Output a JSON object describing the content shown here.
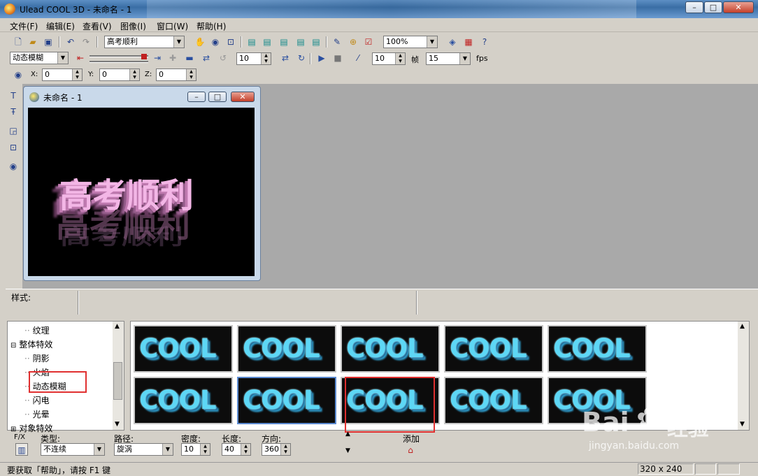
{
  "window": {
    "title": "Ulead COOL 3D - 未命名 - 1",
    "min_glyph": "–",
    "max_glyph": "□",
    "close_glyph": "✕"
  },
  "menu": {
    "items": [
      "文件(F)",
      "编辑(E)",
      "查看(V)",
      "图像(I)",
      "窗口(W)",
      "帮助(H)"
    ]
  },
  "toolbar1": {
    "text_combo": "高考顺利",
    "zoom_combo": "100%"
  },
  "toolbar2": {
    "effect_combo": "动态模糊",
    "frames_value": "10",
    "frames_value2": "10",
    "frame_label": "帧",
    "fps_value": "15",
    "fps_label": "fps"
  },
  "toolbar3": {
    "x_label": "X:",
    "x_value": "0",
    "y_label": "Y:",
    "y_value": "0",
    "z_label": "Z:",
    "z_value": "0"
  },
  "document": {
    "title": "未命名 - 1",
    "canvas_text": "高考顺利"
  },
  "style_bar": {
    "label": "样式:"
  },
  "tree": {
    "items": [
      {
        "label": "纹理",
        "indent": 2,
        "expander": ""
      },
      {
        "label": "整体特效",
        "indent": 1,
        "expander": "⊟"
      },
      {
        "label": "阴影",
        "indent": 2,
        "expander": ""
      },
      {
        "label": "火焰",
        "indent": 2,
        "expander": ""
      },
      {
        "label": "动态模糊",
        "indent": 2,
        "expander": ""
      },
      {
        "label": "闪电",
        "indent": 2,
        "expander": ""
      },
      {
        "label": "光晕",
        "indent": 2,
        "expander": ""
      },
      {
        "label": "对象特效",
        "indent": 1,
        "expander": "⊞"
      }
    ],
    "highlighted": "动态模糊"
  },
  "gallery": {
    "thumb_text": "COOL",
    "thumbs": [
      1,
      2,
      3,
      4,
      5,
      6,
      7,
      8,
      9,
      10
    ],
    "selected_index": 7
  },
  "params": {
    "fx_label": "F/X",
    "type_label": "类型:",
    "type_value": "不连续",
    "path_label": "路径:",
    "path_value": "旋涡",
    "density_label": "密度:",
    "density_value": "10",
    "length_label": "长度:",
    "length_value": "40",
    "direction_label": "方向:",
    "direction_value": "360",
    "add_label": "添加"
  },
  "status": {
    "help_text": "要获取「帮助」，请按 F1 键",
    "size": "320 x 240"
  },
  "watermark": {
    "brand": "Bai",
    "brand2": "经验",
    "url": "jingyan.baidu.com"
  },
  "colors": {
    "accent_blue": "#3a6ea5",
    "thumb_text": "#5dd7f5",
    "canvas_text": "#f3b6e6",
    "highlight_red": "#e03030"
  }
}
